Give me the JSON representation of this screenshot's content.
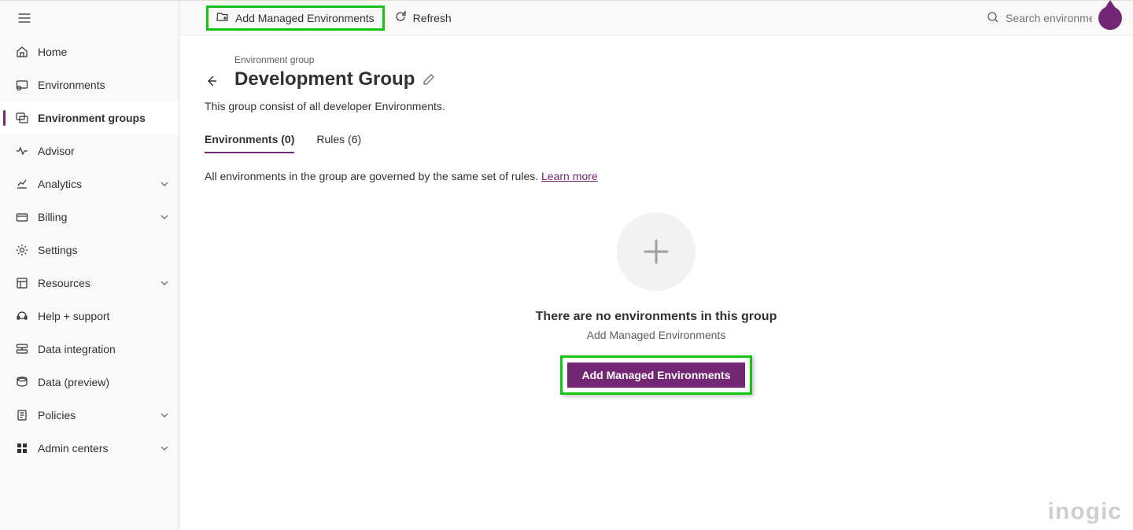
{
  "sidebar": {
    "items": [
      {
        "label": "Home",
        "icon": "home-icon"
      },
      {
        "label": "Environments",
        "icon": "environments-icon"
      },
      {
        "label": "Environment groups",
        "icon": "environment-groups-icon",
        "active": true
      },
      {
        "label": "Advisor",
        "icon": "advisor-icon"
      },
      {
        "label": "Analytics",
        "icon": "analytics-icon",
        "chevron": true
      },
      {
        "label": "Billing",
        "icon": "billing-icon",
        "chevron": true
      },
      {
        "label": "Settings",
        "icon": "settings-icon"
      },
      {
        "label": "Resources",
        "icon": "resources-icon",
        "chevron": true
      },
      {
        "label": "Help + support",
        "icon": "support-icon"
      },
      {
        "label": "Data integration",
        "icon": "data-integration-icon"
      },
      {
        "label": "Data (preview)",
        "icon": "data-preview-icon"
      },
      {
        "label": "Policies",
        "icon": "policies-icon",
        "chevron": true
      },
      {
        "label": "Admin centers",
        "icon": "admin-centers-icon",
        "chevron": true
      }
    ]
  },
  "commandbar": {
    "add_managed": "Add Managed Environments",
    "refresh": "Refresh",
    "search_placeholder": "Search environme"
  },
  "header": {
    "breadcrumb": "Environment group",
    "title": "Development Group",
    "description": "This group consist of all developer Environments."
  },
  "tabs": {
    "environments": "Environments (0)",
    "rules": "Rules (6)"
  },
  "governed": {
    "text": "All environments in the group are governed by the same set of rules. ",
    "link": "Learn more"
  },
  "empty": {
    "heading": "There are no environments in this group",
    "sub": "Add Managed Environments",
    "button": "Add Managed Environments"
  },
  "watermark": "inogic"
}
